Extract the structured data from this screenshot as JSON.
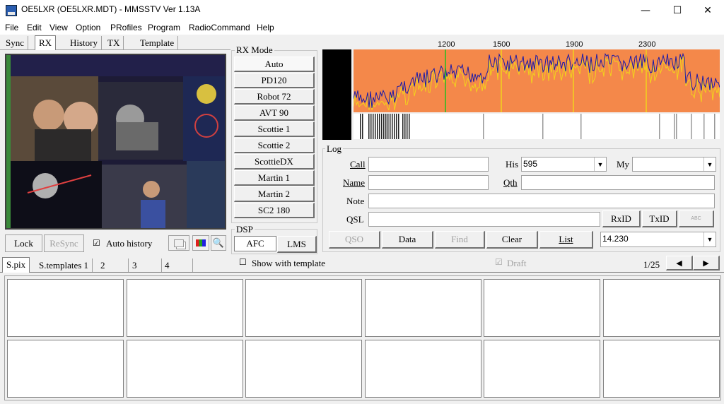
{
  "window": {
    "title": "OE5LXR (OE5LXR.MDT) - MMSSTV Ver 1.13A",
    "minimize": "—",
    "maximize": "☐",
    "close": "✕"
  },
  "menu": [
    "File",
    "Edit",
    "View",
    "Option",
    "PRofiles",
    "Program",
    "RadioCommand",
    "Help"
  ],
  "tabs": [
    "Sync",
    "RX",
    "History",
    "TX",
    "Template"
  ],
  "rx_buttons": {
    "lock": "Lock",
    "resync": "ReSync",
    "auto_history_checked": "☑",
    "auto_history": "Auto history"
  },
  "rx_mode": {
    "label": "RX Mode",
    "modes": [
      "Auto",
      "PD120",
      "Robot 72",
      "AVT 90",
      "Scottie 1",
      "Scottie 2",
      "ScottieDX",
      "Martin 1",
      "Martin 2",
      "SC2 180"
    ]
  },
  "dsp": {
    "label": "DSP",
    "afc": "AFC",
    "lms": "LMS"
  },
  "spectrum": {
    "ticks": [
      "1200",
      "1500",
      "1900",
      "2300"
    ]
  },
  "log": {
    "label": "Log",
    "call_label": "Call",
    "call": "",
    "his_label": "His",
    "his": "595",
    "my_label": "My",
    "my": "",
    "name_label": "Name",
    "name": "",
    "qth_label": "Qth",
    "qth": "",
    "note_label": "Note",
    "note": "",
    "qsl_label": "QSL",
    "qsl": "",
    "rxid": "RxID",
    "txid": "TxID",
    "abc": "ABC",
    "qso": "QSO",
    "data": "Data",
    "find": "Find",
    "clear": "Clear",
    "list": "List",
    "freq": "14.230"
  },
  "template_tabs": [
    "S.pix",
    "S.templates 1",
    "2",
    "3",
    "4"
  ],
  "show_with_template_box": "☐",
  "show_with_template": "Show with template",
  "draft_box": "☑",
  "draft": "Draft",
  "page_indicator": "1/25",
  "nav": {
    "prev": "◀",
    "next": "▶"
  },
  "colors": {
    "spectrum_bg": "#f4884a",
    "trace_blue": "#1a1aa8",
    "trace_yellow": "#f2d21c",
    "window_bg": "#f0f0f0"
  }
}
